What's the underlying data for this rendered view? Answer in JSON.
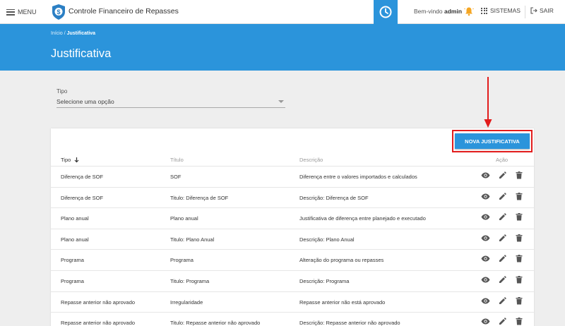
{
  "header": {
    "menu_label": "MENU",
    "app_title": "Controle Financeiro de Repasses",
    "welcome_prefix": "Bem-vindo",
    "user": "admin",
    "sistemas_label": "SISTEMAS",
    "sair_label": "SAIR"
  },
  "banner": {
    "breadcrumb_home": "Início",
    "breadcrumb_sep": "/",
    "breadcrumb_current": "Justificativa",
    "title": "Justificativa"
  },
  "filter": {
    "label": "Tipo",
    "value": "Selecione uma opção"
  },
  "table": {
    "new_button": "NOVA JUSTIFICATIVA",
    "columns": {
      "tipo": "Tipo",
      "titulo": "Título",
      "descricao": "Descrição",
      "acao": "Ação"
    },
    "rows": [
      {
        "tipo": "Diferença de SOF",
        "titulo": "SOF",
        "descricao": "Diferença entre o valores importados e calculados"
      },
      {
        "tipo": "Diferença de SOF",
        "titulo": "Titulo: Diferença de SOF",
        "descricao": "Descrição: Diferença de SOF"
      },
      {
        "tipo": "Plano anual",
        "titulo": "Plano anual",
        "descricao": "Justificativa de diferença entre planejado e executado"
      },
      {
        "tipo": "Plano anual",
        "titulo": "Titulo: Plano Anual",
        "descricao": "Descrição: Plano Anual"
      },
      {
        "tipo": "Programa",
        "titulo": "Programa",
        "descricao": "Alteração do programa ou repasses"
      },
      {
        "tipo": "Programa",
        "titulo": "Titulo: Programa",
        "descricao": "Descrição: Programa"
      },
      {
        "tipo": "Repasse anterior não aprovado",
        "titulo": "Irregularidade",
        "descricao": "Repasse anterior não está aprovado"
      },
      {
        "tipo": "Repasse anterior não aprovado",
        "titulo": "Titulo: Repasse anterior não aprovado",
        "descricao": "Descrição: Repasse anterior não aprovado"
      }
    ]
  },
  "colors": {
    "primary": "#2b94db",
    "highlight": "#e21c1c",
    "bell": "#f5a623"
  },
  "icons": [
    "menu-icon",
    "logo-icon",
    "clock-icon",
    "bell-icon",
    "grid-icon",
    "logout-icon",
    "sort-arrow-icon",
    "eye-icon",
    "edit-icon",
    "trash-icon"
  ]
}
